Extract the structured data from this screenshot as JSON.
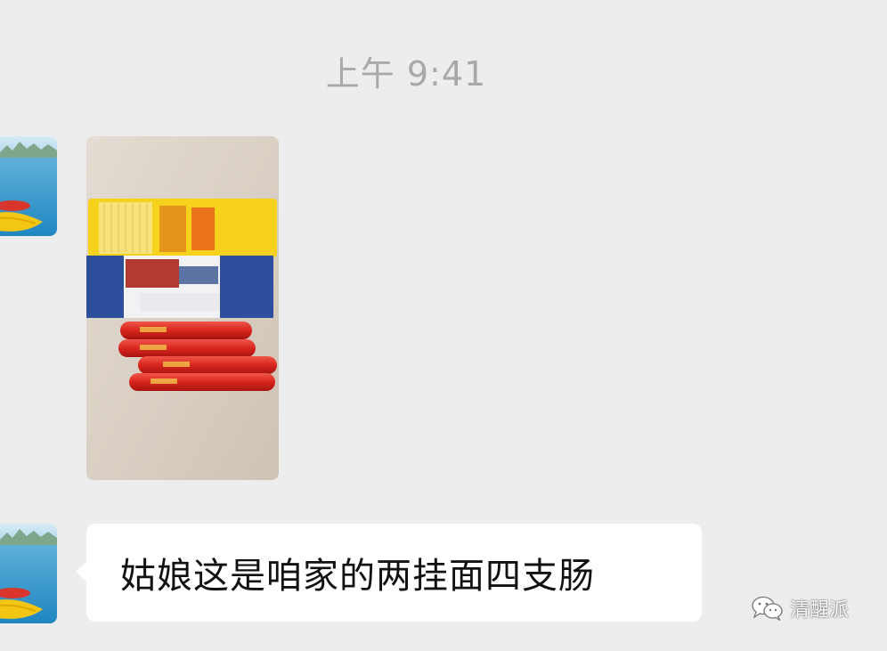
{
  "chat": {
    "timestamp": "上午 9:41",
    "messages": [
      {
        "type": "image",
        "sender": "contact",
        "photo": "photo-noodles-sausages"
      },
      {
        "type": "text",
        "sender": "contact",
        "text": "姑娘这是咱家的两挂面四支肠"
      }
    ]
  },
  "watermark": {
    "text": "清醒派",
    "icon": "wechat-icon"
  },
  "colors": {
    "background": "#ededed",
    "bubble": "#ffffff",
    "timestamp": "#a9a9a9",
    "text": "#111111"
  }
}
